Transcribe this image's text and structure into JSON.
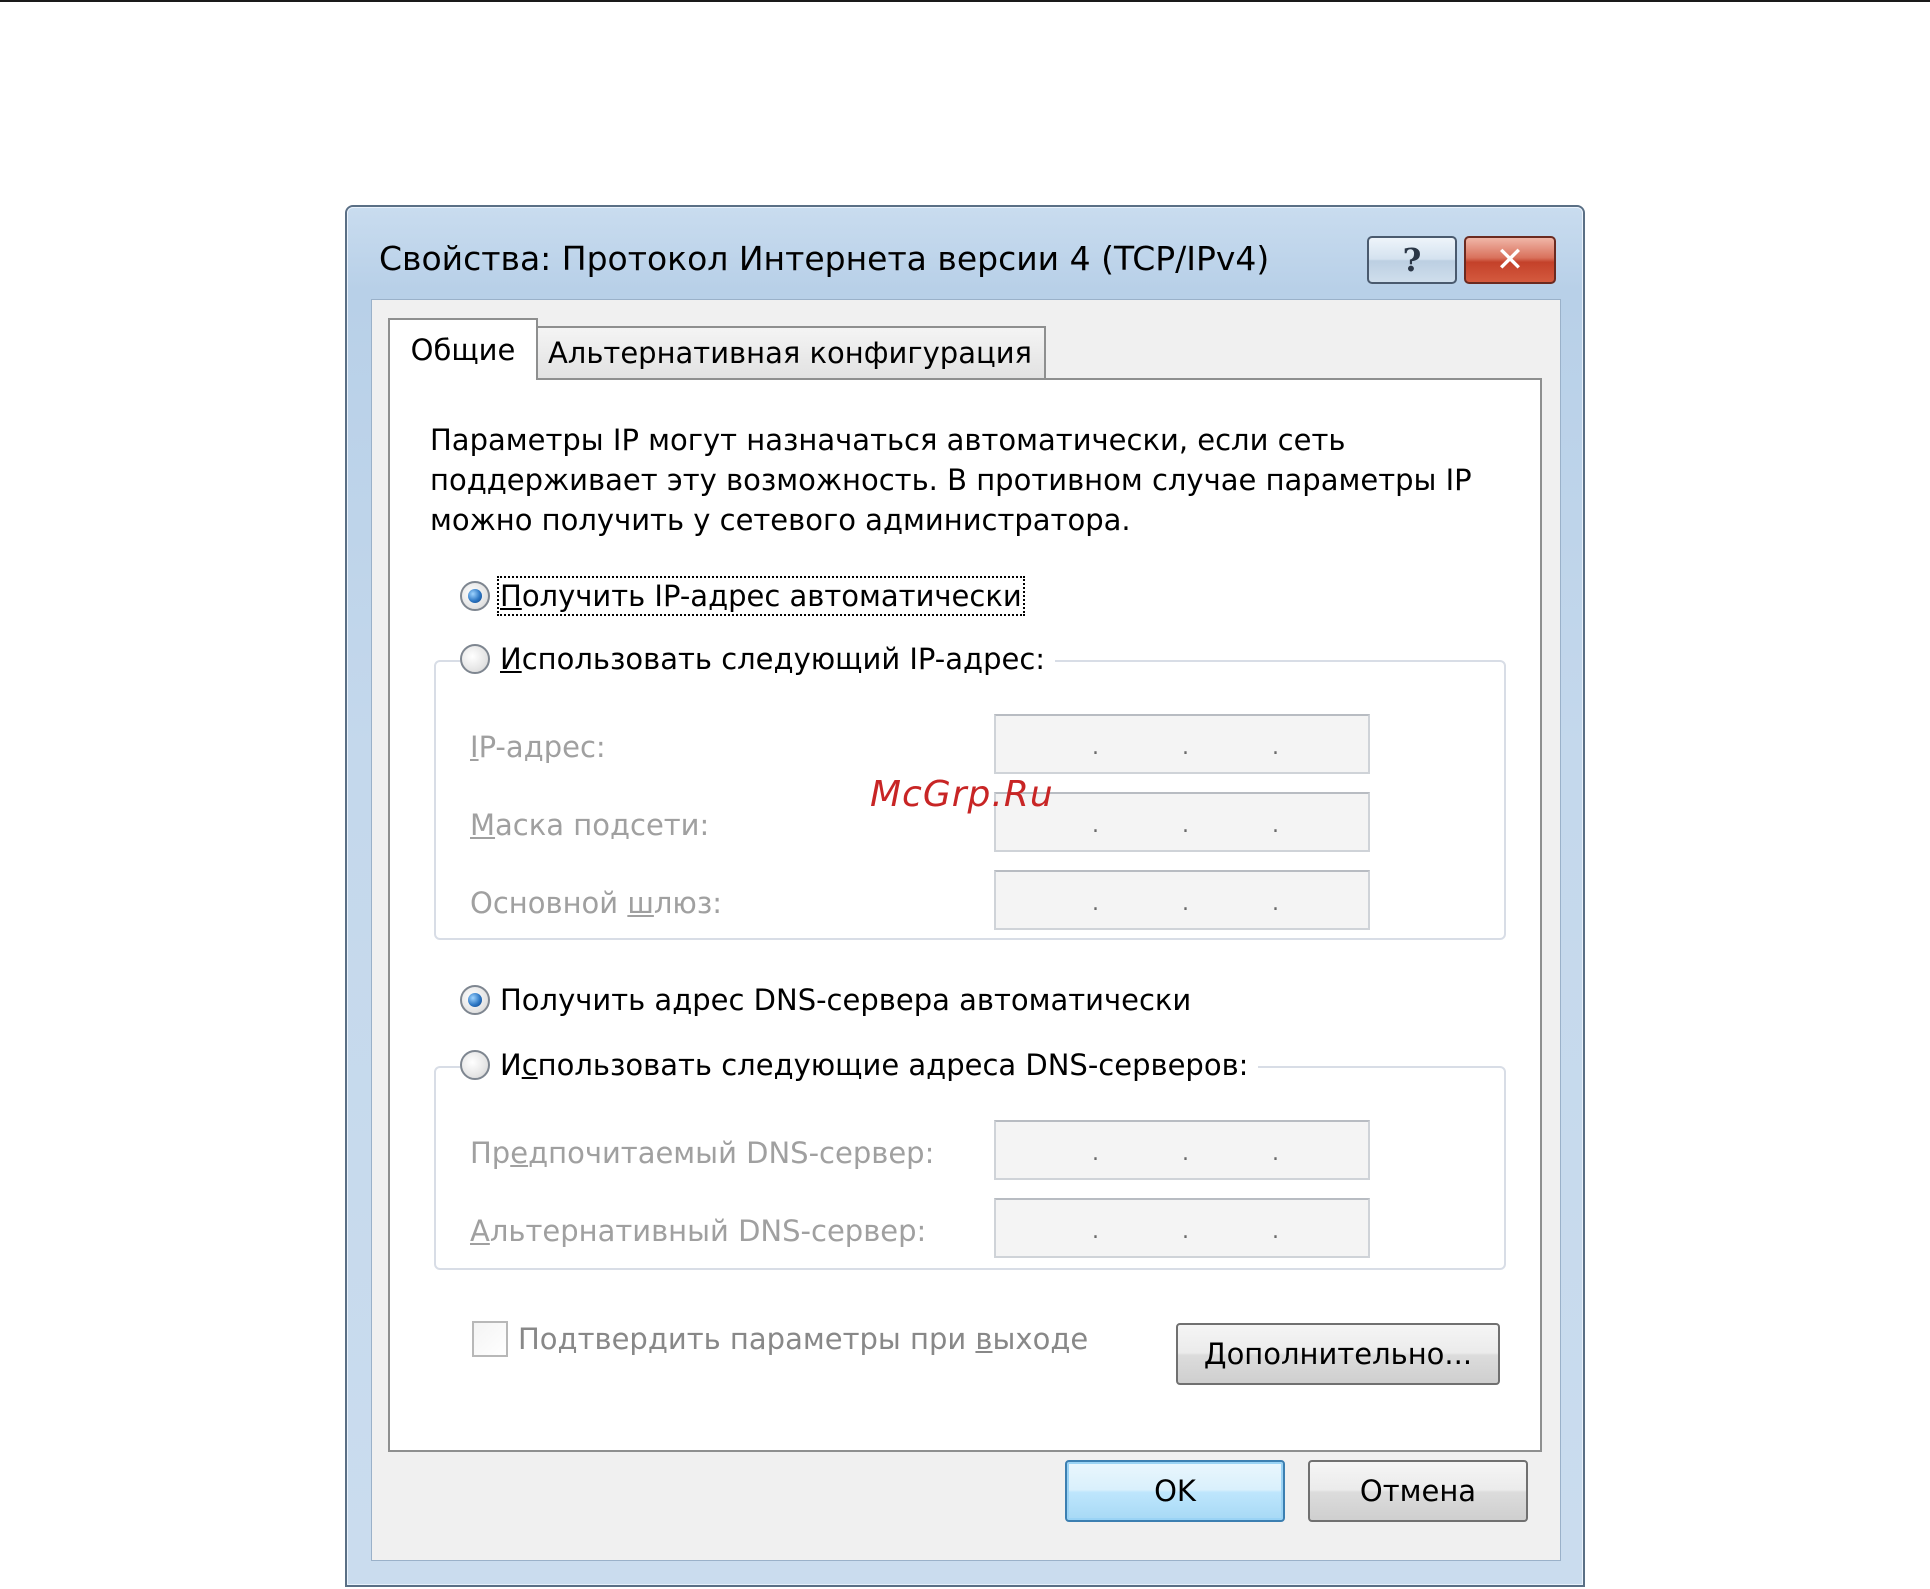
{
  "window": {
    "title": "Свойства: Протокол Интернета версии 4 (TCP/IPv4)",
    "help_glyph": "?",
    "close_glyph": "✕"
  },
  "tabs": [
    {
      "label": "Общие",
      "active": true
    },
    {
      "label": "Альтернативная конфигурация",
      "active": false
    }
  ],
  "description": "Параметры IP могут назначаться автоматически, если сеть поддерживает эту возможность. В противном случае параметры IP можно получить у сетевого администратора.",
  "ip": {
    "auto_option": {
      "prefix": "",
      "ul": "П",
      "rest": "олучить IP-адрес автоматически",
      "checked": true
    },
    "manual_option": {
      "prefix": "",
      "ul": "И",
      "rest": "спользовать следующий IP-адрес:",
      "checked": false
    },
    "fields": [
      {
        "pre": "",
        "ul": "I",
        "post": "P-адрес:",
        "value": ""
      },
      {
        "pre": "",
        "ul": "М",
        "post": "аска подсети:",
        "value": ""
      },
      {
        "pre": "Основной ",
        "ul": "ш",
        "post": "люз:",
        "value": ""
      }
    ]
  },
  "dns": {
    "auto_option": {
      "prefix": "Получить адрес DNS-сервера автоматически",
      "checked": true
    },
    "manual_option": {
      "prefix": "И",
      "ul": "с",
      "rest": "пользовать следующие адреса DNS-серверов:",
      "checked": false
    },
    "fields": [
      {
        "pre": "Пр",
        "ul": "е",
        "post": "дпочитаемый DNS-сервер:",
        "value": ""
      },
      {
        "pre": "",
        "ul": "А",
        "post": "льтернативный DNS-сервер:",
        "value": ""
      }
    ]
  },
  "validate": {
    "pre": "Подтвердить параметры при ",
    "ul": "в",
    "post": "ыходе",
    "checked": false
  },
  "buttons": {
    "advanced": {
      "ul": "Д",
      "rest": "ополнительно..."
    },
    "ok": "OK",
    "cancel": "Отмена"
  },
  "ip_dots": ".",
  "watermark": "McGrp.Ru"
}
